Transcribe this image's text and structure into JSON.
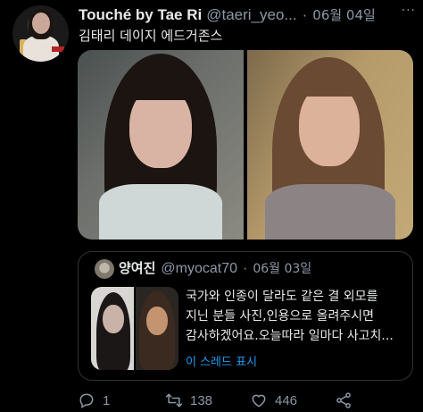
{
  "tweet": {
    "author_name": "Touché by Tae Ri",
    "author_handle": "@taeri_yeo...",
    "separator": "·",
    "date": "06월 04일",
    "more": "···",
    "text": "김태리 데이지 에드거존스"
  },
  "quote": {
    "author_name": "양여진",
    "author_handle": "@myocat70",
    "separator": "·",
    "date": "06월 03일",
    "lines": [
      "국가와 인종이 달라도 같은 결 외모를",
      "지닌 분들 사진,인용으로 올려주시면",
      "감사하겠어요.오늘따라 일마다 사고치..."
    ],
    "show_thread": "이 스레드 표시"
  },
  "actions": {
    "reply_count": "1",
    "retweet_count": "138",
    "like_count": "446"
  },
  "colors": {
    "background": "#000000",
    "text_primary": "#e7e9ea",
    "text_secondary": "#8b98a5",
    "link": "#1d9bf0",
    "border": "#2f3336"
  }
}
